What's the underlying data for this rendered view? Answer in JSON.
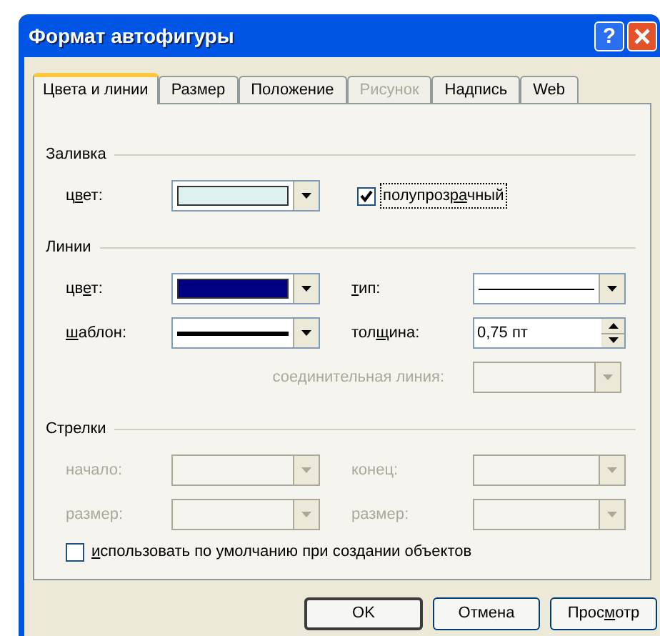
{
  "window": {
    "title": "Формат автофигуры",
    "help": "?"
  },
  "tabs": [
    {
      "label": "Цвета и линии",
      "selected": true,
      "disabled": false
    },
    {
      "label": "Размер",
      "selected": false,
      "disabled": false
    },
    {
      "label": "Положение",
      "selected": false,
      "disabled": false
    },
    {
      "label": "Рисунок",
      "selected": false,
      "disabled": true
    },
    {
      "label": "Надпись",
      "selected": false,
      "disabled": false
    },
    {
      "label": "Web",
      "selected": false,
      "disabled": false
    }
  ],
  "sections": [
    {
      "title": "Заливка",
      "rows": [
        [
          {
            "kind": "color",
            "label": {
              "pre": "ц",
              "key": "в",
              "post": "ет:"
            },
            "color": "#dff0f0",
            "disabled": false
          },
          {
            "kind": "checkbox",
            "label": {
              "pre": "полупроз",
              "key": "ра",
              "post": "чный"
            },
            "checked": true,
            "focused": true
          }
        ]
      ]
    },
    {
      "title": "Линии",
      "rows": [
        [
          {
            "kind": "color",
            "label": {
              "pre": "цв",
              "key": "е",
              "post": "т:"
            },
            "color": "#000080",
            "disabled": false
          },
          {
            "kind": "thinline",
            "label": {
              "key": "т",
              "post": "ип:"
            },
            "disabled": false
          }
        ],
        [
          {
            "kind": "thickline",
            "label": {
              "key": "ш",
              "post": "аблон:"
            },
            "disabled": false
          },
          {
            "kind": "spin",
            "label": {
              "pre": "тол",
              "key": "щ",
              "post": "ина:"
            },
            "value": "0,75 пт"
          }
        ],
        [
          {
            "kind": "wide",
            "label": {
              "pre": "соединительная линия:"
            },
            "disabled": true
          }
        ]
      ]
    },
    {
      "title": "Стрелки",
      "rows": [
        [
          {
            "kind": "empty",
            "label": {
              "pre": "начало:"
            },
            "disabled": true
          },
          {
            "kind": "empty",
            "label": {
              "pre": "конец:"
            },
            "disabled": true
          }
        ],
        [
          {
            "kind": "empty",
            "label": {
              "pre": "размер:"
            },
            "disabled": true
          },
          {
            "kind": "empty",
            "label": {
              "pre": "размер:"
            },
            "disabled": true
          }
        ]
      ]
    }
  ],
  "default_checkbox": {
    "label": {
      "key": "и",
      "post": "спользовать по умолчанию при создании объектов"
    },
    "checked": false
  },
  "buttons": [
    {
      "label": {
        "pre": "OK"
      },
      "default": true
    },
    {
      "label": {
        "pre": "Отмена"
      },
      "default": false
    },
    {
      "label": {
        "pre": "Прос",
        "key": "м",
        "post": "отр"
      },
      "default": false
    }
  ]
}
